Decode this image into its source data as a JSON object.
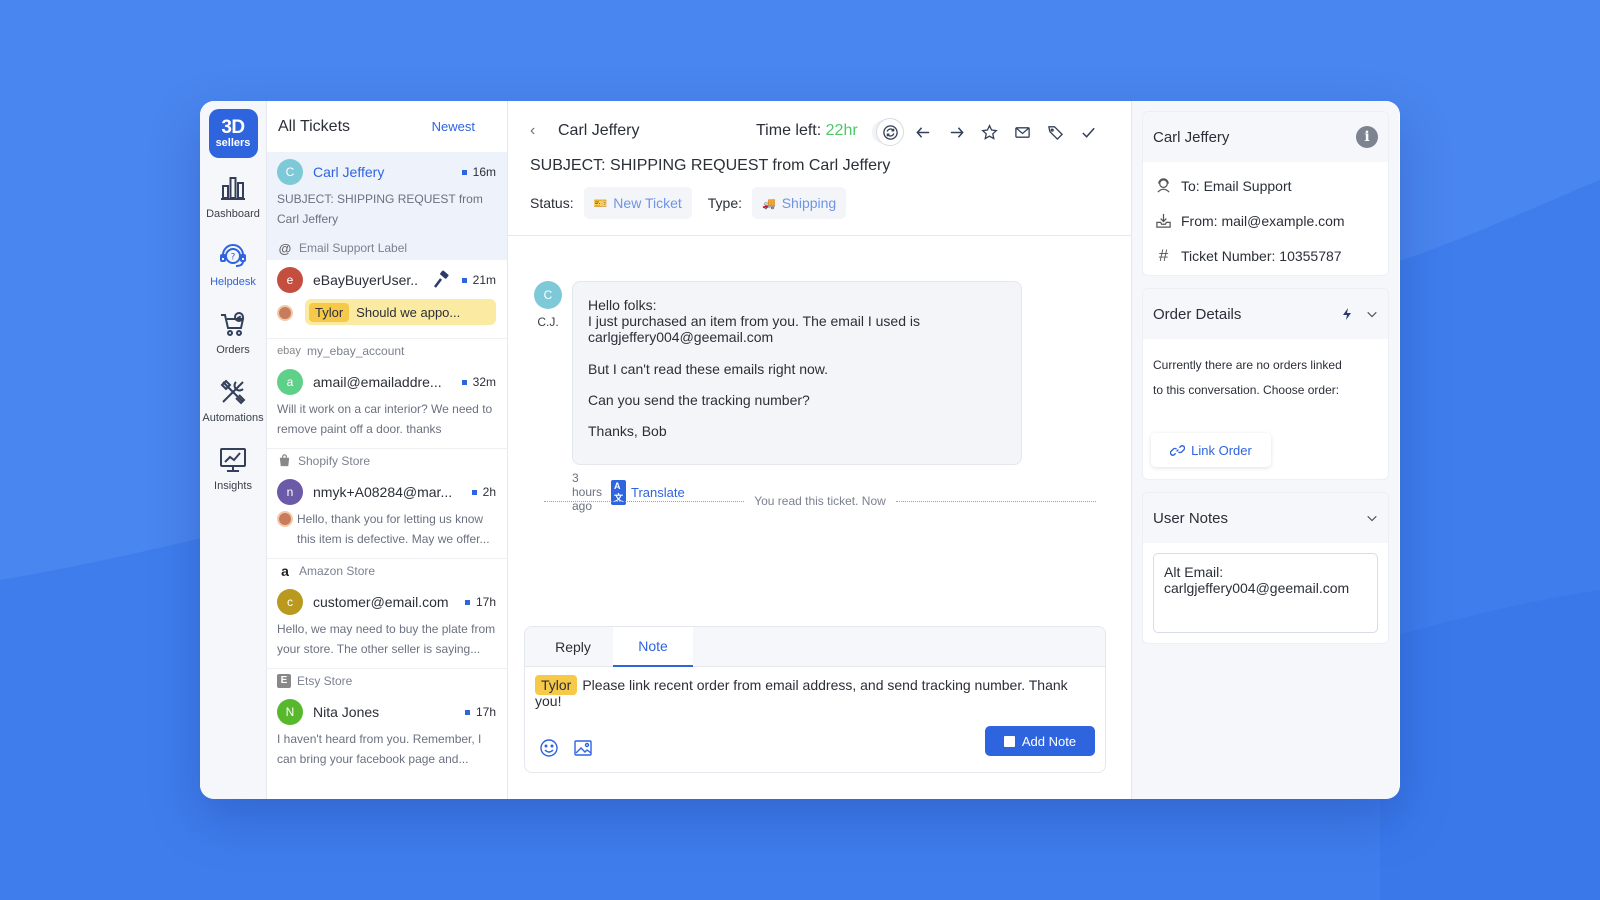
{
  "brand": {
    "logo_top": "3D",
    "logo_bottom": "sellers"
  },
  "nav": [
    {
      "label": "Dashboard",
      "icon": "bar-chart-icon"
    },
    {
      "label": "Helpdesk",
      "icon": "headset-icon",
      "active": true
    },
    {
      "label": "Orders",
      "icon": "cart-icon"
    },
    {
      "label": "Automations",
      "icon": "tools-icon"
    },
    {
      "label": "Insights",
      "icon": "monitor-chart-icon"
    }
  ],
  "list": {
    "title": "All Tickets",
    "sort": "Newest",
    "sections": [
      {
        "label": "Email Support Label",
        "icon": "@"
      },
      {
        "label": "my_ebay_account",
        "icon": "ebay"
      },
      {
        "label": "Shopify Store",
        "icon": "shopify"
      },
      {
        "label": "Amazon Store",
        "icon": "a"
      },
      {
        "label": "Etsy Store",
        "icon": "E"
      }
    ],
    "tickets": [
      {
        "initial": "C",
        "color": "#7ec9d8",
        "name": "Carl Jeffery",
        "time": "16m",
        "preview": "SUBJECT: SHIPPING REQUEST from Carl Jeffery"
      },
      {
        "initial": "e",
        "color": "#c44f3f",
        "name": "eBayBuyerUser..",
        "time": "21m",
        "mention": "Tylor",
        "mention_text": "Should we appo..."
      },
      {
        "initial": "a",
        "color": "#5fd08a",
        "name": "amail@emailaddre...",
        "time": "32m",
        "preview": "Will it work on a car interior? We need to remove paint off a door. thanks"
      },
      {
        "initial": "n",
        "color": "#6a5aa8",
        "name": "nmyk+A08284@mar...",
        "time": "2h",
        "preview": "Hello, thank you for letting us know this item is defective. May we offer..."
      },
      {
        "initial": "c",
        "color": "#b99a1f",
        "name": "customer@email.com",
        "time": "17h",
        "preview": "Hello, we may need to buy the plate from your store. The other seller is saying..."
      },
      {
        "initial": "N",
        "color": "#58b82c",
        "name": "Nita Jones",
        "time": "17h",
        "preview": "I haven't heard from you. Remember, I can bring your facebook page and..."
      }
    ]
  },
  "convo": {
    "name": "Carl Jeffery",
    "time_left_label": "Time left:",
    "time_left_value": "22hr",
    "subject": "SUBJECT: SHIPPING REQUEST from Carl Jeffery",
    "status_label": "Status:",
    "status_value": "New Ticket",
    "type_label": "Type:",
    "type_value": "Shipping",
    "message": {
      "avatar": "C",
      "initials": "C.J.",
      "lines": [
        "Hello folks:",
        "I just purchased an item from you. The email I used is",
        "carlgjeffery004@geemail.com",
        "But I can't read these emails right now.",
        "Can you send the tracking number?",
        "Thanks, Bob"
      ],
      "time": "3 hours ago",
      "translate": "Translate",
      "translate_icon": "A文"
    },
    "read_notice": "You read this ticket. Now",
    "composer": {
      "tab_reply": "Reply",
      "tab_note": "Note",
      "mention": "Tylor",
      "text": "Please link recent order from email address, and send tracking number. Thank you!",
      "button": "Add Note"
    }
  },
  "panel": {
    "contact_name": "Carl Jeffery",
    "to": "To: Email Support",
    "from": "From: mail@example.com",
    "ticket": "Ticket Number: 10355787",
    "order_title": "Order Details",
    "order_text_1": "Currently there are no orders linked",
    "order_text_2": "to this conversation. Choose order:",
    "link_order": "Link Order",
    "notes_title": "User Notes",
    "notes_line1": "Alt Email:",
    "notes_line2": "carlgjeffery004@geemail.com"
  },
  "colors": {
    "accent": "#2f64df",
    "background": "#4a86ef",
    "time_left": "#4cc86a",
    "mention": "#f7c948"
  }
}
